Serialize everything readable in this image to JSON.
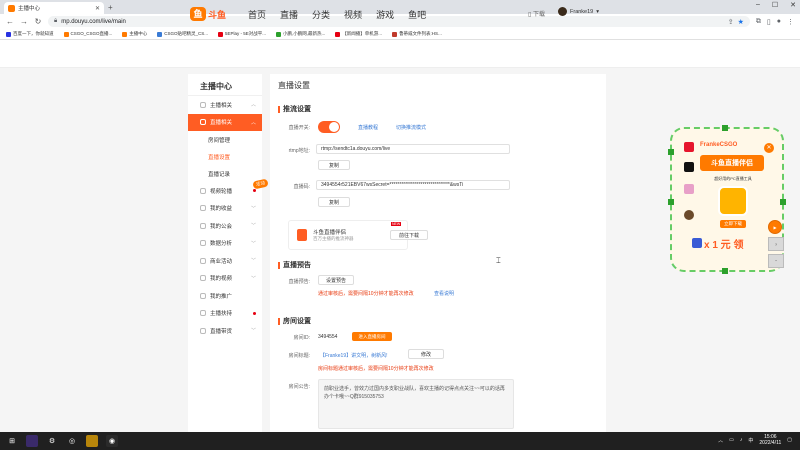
{
  "browser": {
    "tab_title": "主播中心",
    "url": "mp.douyu.com/live/main",
    "bookmarks": [
      "百度一下，你就知道",
      "CSGO_CSGO直播...",
      "主播中心",
      "CSGO贴吧精灵_CS...",
      "5EPlay - 5E对战平...",
      "小鹏,小鹏网,最新热...",
      "【新闻播】单机游...",
      "鲁蒂威文件列表:HS..."
    ]
  },
  "site": {
    "logo_text": "斗鱼",
    "logo_sub": "DOUYU.COM",
    "nav": [
      "首页",
      "直播",
      "分类",
      "视频",
      "游戏",
      "鱼吧"
    ],
    "download": "下载",
    "username": "Franke19"
  },
  "sidebar": {
    "title": "主播中心",
    "items": [
      {
        "label": "主播相关"
      },
      {
        "label": "直播相关"
      },
      {
        "label": "房间管理"
      },
      {
        "label": "直播设置"
      },
      {
        "label": "直播记录"
      },
      {
        "label": "视频轮播"
      },
      {
        "label": "我的收益"
      },
      {
        "label": "我的公会"
      },
      {
        "label": "数据分析"
      },
      {
        "label": "商业活动"
      },
      {
        "label": "我的视频"
      },
      {
        "label": "我的推广"
      },
      {
        "label": "主播扶持"
      },
      {
        "label": "直播带货"
      }
    ],
    "tag": "活动"
  },
  "content": {
    "page_title": "直播设置",
    "stream": {
      "header": "推流设置",
      "switch_label": "直播开关:",
      "link_help": "直播教程",
      "link_pc": "切换推流模式",
      "rtmp_label": "rtmp地址:",
      "rtmp_value": "rtmp://sendtc1a.douyu.com/live",
      "copy": "复制",
      "code_label": "直播码:",
      "code_value": "3494554r521EBV67wsSecret=*******************************&wsTi",
      "copy2": "复制"
    },
    "promo": {
      "title": "斗鱼直播伴侣",
      "sub": "百万主播的推流神器",
      "badge": "NEW",
      "button": "前往下载"
    },
    "preview": {
      "header": "直播预告",
      "label": "直播预告:",
      "button": "设置预告",
      "warn": "通过审核后，需要间隔10分钟才能再次修改",
      "link": "查看说明"
    },
    "room": {
      "header": "房间设置",
      "id_label": "房间ID:",
      "id_value": "3494554",
      "enter_button": "进入直播房间",
      "name_label": "房间标题:",
      "name_value": "【Franke19】讲文明，树新风!",
      "edit_button": "修改",
      "name_warn": "房间标题通过审核后，需要间隔10分钟才能再次修改",
      "notice_label": "房间公告:",
      "notice_text": "前职业选手，曾效力过国内多支职业战队，喜欢主播的记得点点关注~~可以的话再办个卡哦~~Q群915035753"
    }
  },
  "ad": {
    "title": "FrankeCSGO",
    "banner": "斗鱼直播伴侣",
    "sub": "超好用的PC直播工具",
    "button": "立即下载",
    "big": "x 1 元 领"
  },
  "taskbar": {
    "time": "15:06",
    "date": "2022/4/11",
    "lang": "中"
  },
  "colors": {
    "accent": "#ff5d23",
    "orange": "#ff7a00",
    "link": "#3a7bd5",
    "warn": "#e8380d"
  }
}
